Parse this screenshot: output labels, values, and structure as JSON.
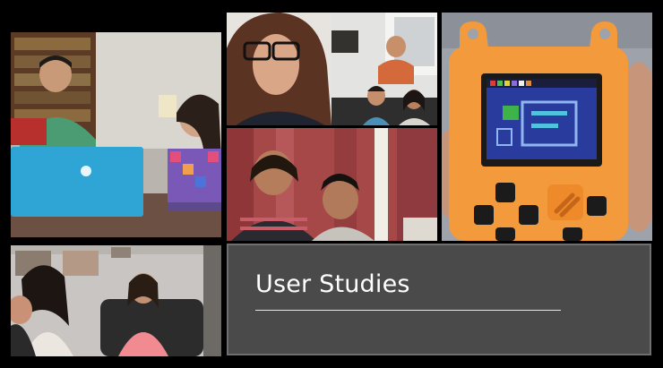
{
  "title_slide": {
    "heading": "User Studies"
  }
}
